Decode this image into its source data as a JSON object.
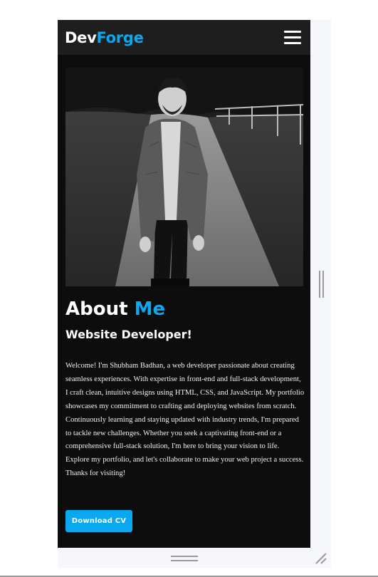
{
  "navbar": {
    "logo_part1": "Dev",
    "logo_part2": "Forge",
    "menu_icon": "hamburger-menu-icon"
  },
  "about": {
    "photo_description": "profile-photo",
    "heading_part1": "About ",
    "heading_part2": "Me",
    "subheading": "Website Developer!",
    "bio": "Welcome! I'm Shubham Badhan, a web developer passionate about creating seamless experiences. With expertise in front-end and full-stack development, I craft clean, intuitive designs using HTML, CSS, and JavaScript. My portfolio showcases my commitment to crafting and deploying websites from scratch. Continuously learning and staying updated with industry trends, I'm prepared to tackle new challenges. Whether you seek a captivating front-end or a comprehensive full-stack solution, I'm here to bring your vision to life. Explore my portfolio, and let's collaborate to make your web project a success. Thanks for visiting!",
    "cv_button_label": "Download CV"
  },
  "colors": {
    "accent": "#0aa8f0",
    "background": "#0d0d0d",
    "navbar": "#1e1e1e"
  }
}
